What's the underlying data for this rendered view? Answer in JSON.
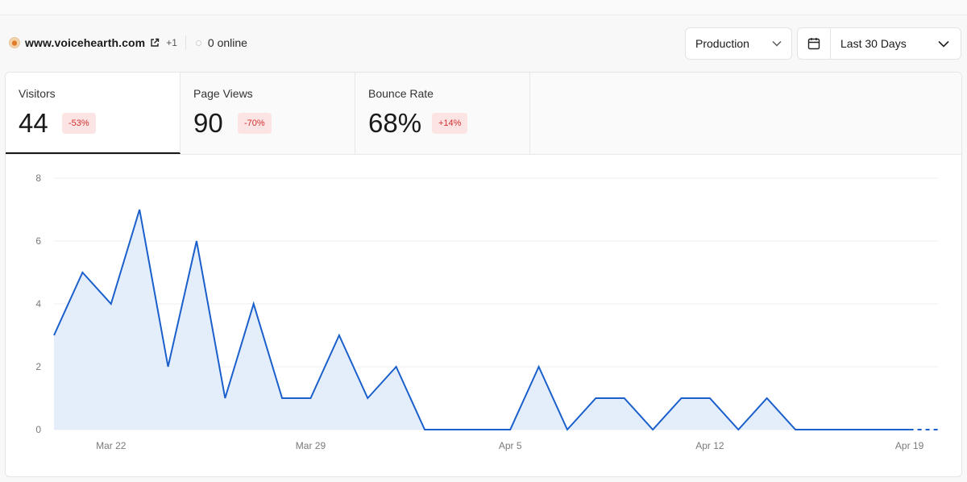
{
  "header": {
    "site_name": "www.voicehearth.com",
    "extra_sites": "+1",
    "online": "0 online",
    "environment": "Production",
    "date_range": "Last 30 Days"
  },
  "icons": {
    "favicon": "site-favicon",
    "external": "external-link-icon",
    "calendar": "calendar-icon",
    "chevron": "chevron-down-icon"
  },
  "tabs": [
    {
      "label": "Visitors",
      "value": "44",
      "change": "-53%",
      "active": true
    },
    {
      "label": "Page Views",
      "value": "90",
      "change": "-70%",
      "active": false
    },
    {
      "label": "Bounce Rate",
      "value": "68%",
      "change": "+14%",
      "active": false
    }
  ],
  "colors": {
    "line": "#1a5fcc",
    "area": "#e4eefb",
    "badge_bg": "#fde4e4",
    "badge_text": "#d0302f"
  },
  "chart_data": {
    "type": "area",
    "x": [
      "Mar 20",
      "Mar 21",
      "Mar 22",
      "Mar 23",
      "Mar 24",
      "Mar 25",
      "Mar 26",
      "Mar 27",
      "Mar 28",
      "Mar 29",
      "Mar 30",
      "Mar 31",
      "Apr 1",
      "Apr 2",
      "Apr 3",
      "Apr 4",
      "Apr 5",
      "Apr 6",
      "Apr 7",
      "Apr 8",
      "Apr 9",
      "Apr 10",
      "Apr 11",
      "Apr 12",
      "Apr 13",
      "Apr 14",
      "Apr 15",
      "Apr 16",
      "Apr 17",
      "Apr 18",
      "Apr 19",
      "Apr 20"
    ],
    "series": [
      {
        "values": [
          3,
          5,
          4,
          7,
          2,
          6,
          1,
          4,
          1,
          1,
          3,
          1,
          2,
          0,
          0,
          0,
          0,
          2,
          0,
          1,
          1,
          0,
          1,
          1,
          0,
          1,
          0,
          0,
          0,
          0,
          0,
          0
        ],
        "dashed_from": "Apr 19"
      }
    ],
    "ylim": [
      0,
      8
    ],
    "yticks": [
      "0",
      "2",
      "4",
      "6",
      "8"
    ],
    "xticks": [
      "Mar 22",
      "Mar 29",
      "Apr 5",
      "Apr 12",
      "Apr 19"
    ],
    "grid": true
  }
}
